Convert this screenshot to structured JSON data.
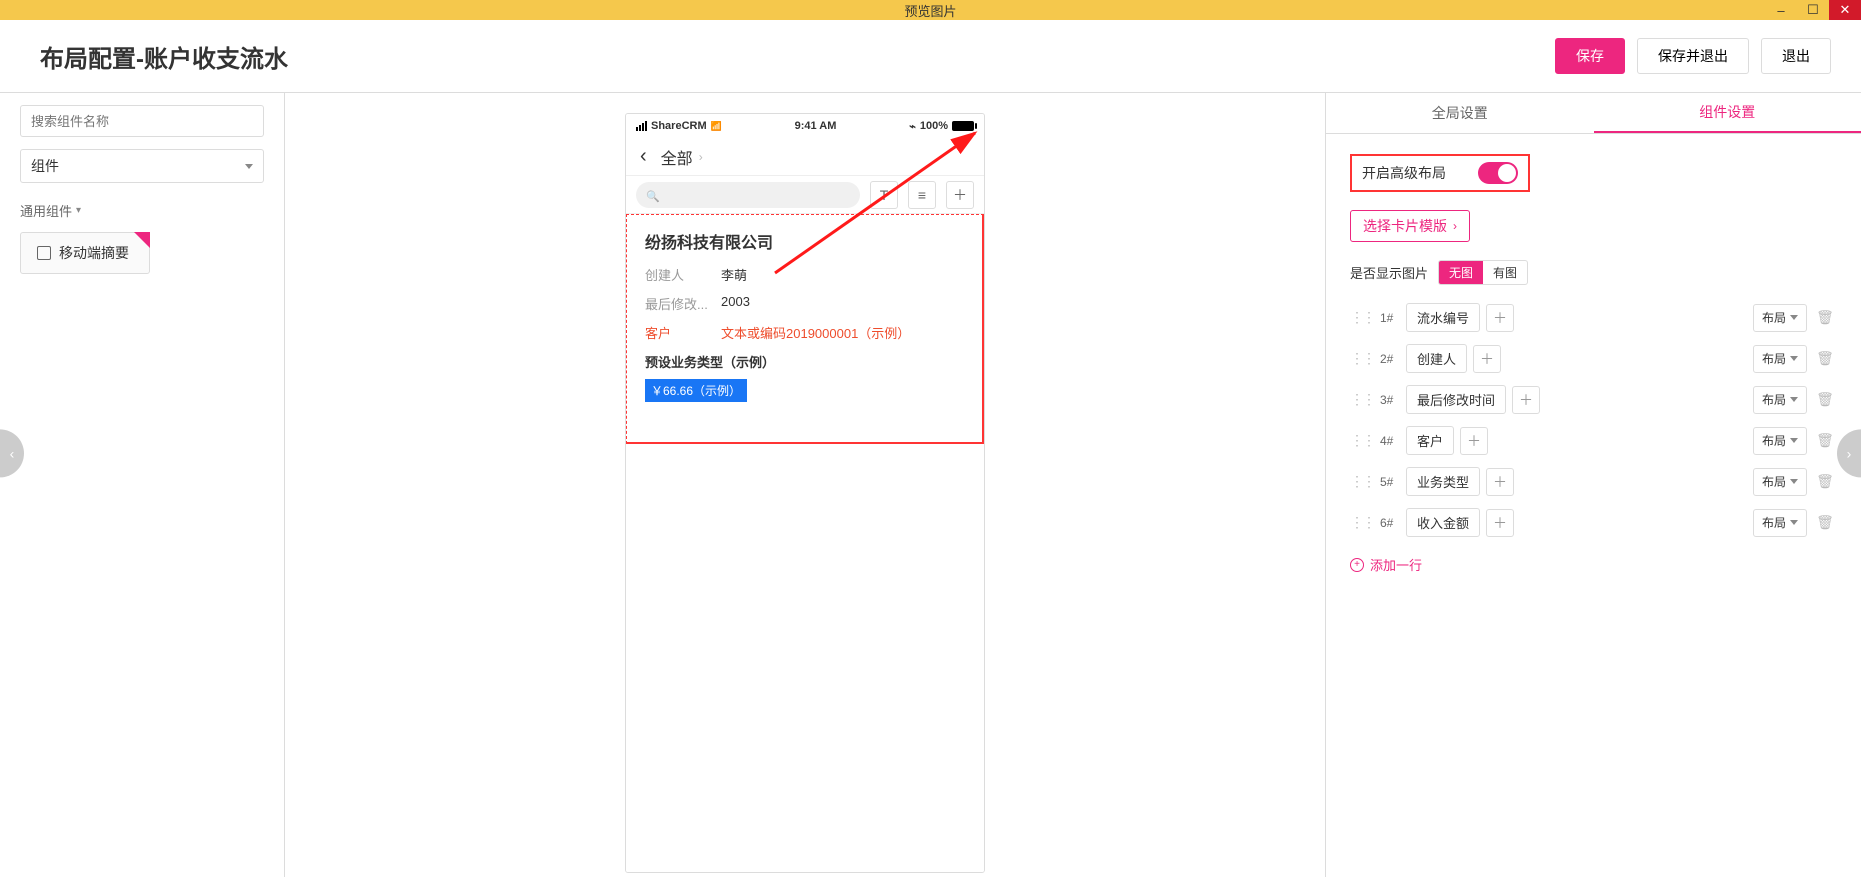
{
  "window": {
    "title": "预览图片"
  },
  "header": {
    "title": "布局配置-账户收支流水",
    "save": "保存",
    "save_exit": "保存并退出",
    "exit": "退出"
  },
  "left": {
    "search_placeholder": "搜索组件名称",
    "dropdown_label": "组件",
    "section_label": "通用组件",
    "chip_label": "移动端摘要"
  },
  "phone": {
    "carrier": "ShareCRM",
    "time": "9:41 AM",
    "battery_pct": "100%",
    "nav_title": "全部",
    "card": {
      "company": "纷扬科技有限公司",
      "creator_label": "创建人",
      "creator_value": "李萌",
      "modified_label": "最后修改...",
      "modified_value": "2003",
      "customer_label": "客户",
      "customer_value": "文本或编码2019000001（示例）",
      "biztype_label": "预设业务类型（示例）",
      "amount_badge": "￥66.66（示例）"
    }
  },
  "right": {
    "tabs": {
      "global": "全局设置",
      "component": "组件设置"
    },
    "advanced_label": "开启高级布局",
    "template_btn": "选择卡片模版",
    "show_image_label": "是否显示图片",
    "seg": {
      "no_img": "无图",
      "with_img": "有图"
    },
    "layout_label": "布局",
    "rows": [
      {
        "idx": "1#",
        "label": "流水编号"
      },
      {
        "idx": "2#",
        "label": "创建人"
      },
      {
        "idx": "3#",
        "label": "最后修改时间"
      },
      {
        "idx": "4#",
        "label": "客户"
      },
      {
        "idx": "5#",
        "label": "业务类型"
      },
      {
        "idx": "6#",
        "label": "收入金额"
      }
    ],
    "add_row": "添加一行"
  }
}
